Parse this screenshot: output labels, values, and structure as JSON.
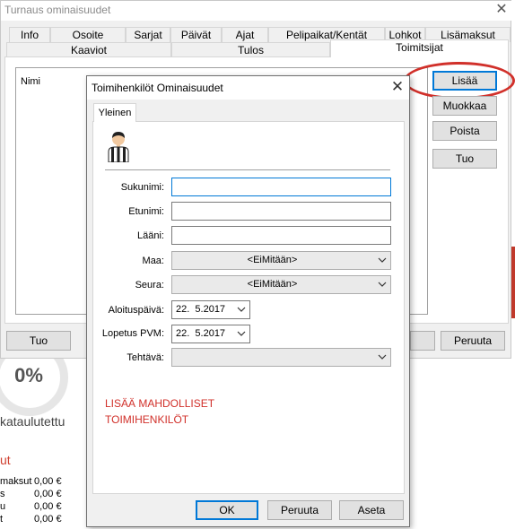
{
  "background": {
    "progress_pct": "0%",
    "unscheduled": "kataulutettu",
    "red_heading": "ut",
    "fees": [
      {
        "label": "maksut",
        "value": "0,00 €"
      },
      {
        "label": "s",
        "value": "0,00 €"
      },
      {
        "label": "u",
        "value": "0,00 €"
      },
      {
        "label": "t",
        "value": "0,00 €"
      }
    ]
  },
  "window": {
    "title": "Turnaus ominaisuudet",
    "close": "✕",
    "tabs_row1": [
      "Info",
      "Osoite",
      "Sarjat",
      "Päivät",
      "Ajat",
      "Pelipaikat/Kentät",
      "Lohkot",
      "Lisämaksut"
    ],
    "tabs_row2": [
      "Kaaviot",
      "Tulos",
      "Toimitsijat"
    ],
    "list_header": "Nimi",
    "side_buttons": {
      "add": "Lisää",
      "edit": "Muokkaa",
      "delete": "Poista",
      "import": "Tuo"
    },
    "bottom_left": "Tuo",
    "bottom_right": "Peruuta"
  },
  "dialog": {
    "title": "Toimihenkilöt Ominaisuudet",
    "close": "✕",
    "tab": "Yleinen",
    "icon": "referee-icon",
    "fields": {
      "surname": {
        "label": "Sukunimi:",
        "value": ""
      },
      "firstname": {
        "label": "Etunimi:",
        "value": ""
      },
      "county": {
        "label": "Lääni:",
        "value": ""
      },
      "country": {
        "label": "Maa:",
        "value": "<EiMitään>"
      },
      "club": {
        "label": "Seura:",
        "value": "<EiMitään>"
      },
      "start_date": {
        "label": "Aloituspäivä:",
        "value": "22.  5.2017"
      },
      "end_date": {
        "label": "Lopetus PVM:",
        "value": "22.  5.2017"
      },
      "task": {
        "label": "Tehtävä:",
        "value": ""
      }
    },
    "note_line1": "LISÄÄ MAHDOLLISET",
    "note_line2": "TOIMIHENKILÖT",
    "buttons": {
      "ok": "OK",
      "cancel": "Peruuta",
      "apply": "Aseta"
    }
  }
}
